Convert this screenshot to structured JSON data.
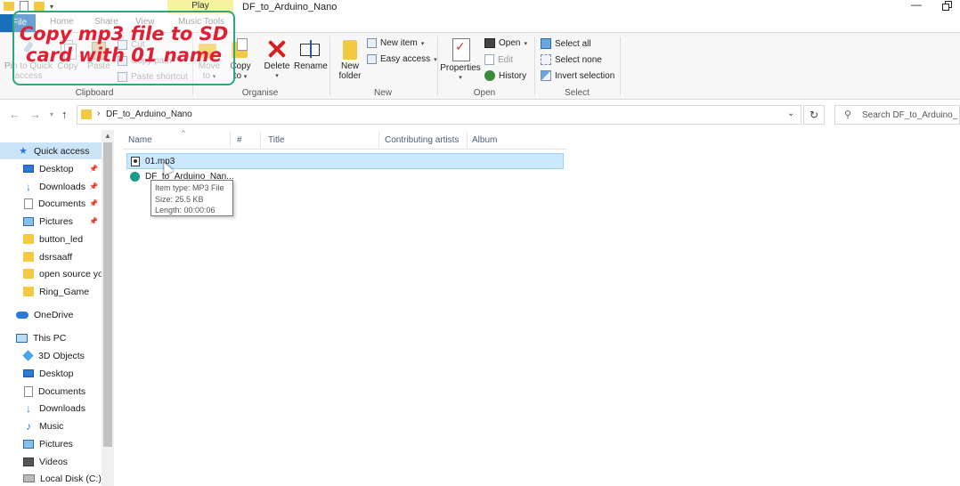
{
  "titlebar": {
    "contextual_tab": "Play",
    "window_title": "DF_to_Arduino_Nano",
    "minimize": "—"
  },
  "ribbon_tabs": {
    "file": "File",
    "home": "Home",
    "share": "Share",
    "view": "View",
    "music_tools": "Music Tools"
  },
  "ribbon": {
    "clipboard": {
      "pin_line1": "Pin to Quick",
      "pin_line2": "access",
      "copy": "Copy",
      "paste": "Paste",
      "cut": "Cut",
      "copy_path": "Copy path",
      "paste_shortcut": "Paste shortcut",
      "label": "Clipboard"
    },
    "organise": {
      "move_line1": "Move",
      "move_line2": "to",
      "copy_line1": "Copy",
      "copy_line2": "to",
      "delete": "Delete",
      "rename": "Rename",
      "label": "Organise"
    },
    "new": {
      "new_folder_line1": "New",
      "new_folder_line2": "folder",
      "new_item": "New item",
      "easy_access": "Easy access",
      "label": "New"
    },
    "open": {
      "properties": "Properties",
      "open": "Open",
      "edit": "Edit",
      "history": "History",
      "label": "Open"
    },
    "select": {
      "select_all": "Select all",
      "select_none": "Select none",
      "invert_selection": "Invert selection",
      "label": "Select"
    }
  },
  "annotation": {
    "line1": "Copy mp3 file to SD",
    "line2": "card with 01 name",
    "color": "#e41e32",
    "border_color": "#2aa878"
  },
  "address": {
    "path": "DF_to_Arduino_Nano",
    "search_placeholder": "Search DF_to_Arduino_N"
  },
  "sidebar": {
    "items": [
      {
        "label": "Quick access",
        "icon": "star-icon",
        "selected": true
      },
      {
        "label": "Desktop",
        "icon": "desktop-icon",
        "pinned": true
      },
      {
        "label": "Downloads",
        "icon": "downloads-icon",
        "pinned": true
      },
      {
        "label": "Documents",
        "icon": "documents-icon",
        "pinned": true
      },
      {
        "label": "Pictures",
        "icon": "pictures-icon",
        "pinned": true
      },
      {
        "label": "button_led",
        "icon": "folder-icon"
      },
      {
        "label": "dsrsaaff",
        "icon": "folder-icon"
      },
      {
        "label": "open source you",
        "icon": "folder-icon"
      },
      {
        "label": "Ring_Game",
        "icon": "folder-icon"
      },
      {
        "label": "OneDrive",
        "icon": "onedrive-icon"
      },
      {
        "label": "This PC",
        "icon": "pc-icon"
      },
      {
        "label": "3D Objects",
        "icon": "3d-objects-icon"
      },
      {
        "label": "Desktop",
        "icon": "desktop-icon"
      },
      {
        "label": "Documents",
        "icon": "documents-icon"
      },
      {
        "label": "Downloads",
        "icon": "downloads-icon"
      },
      {
        "label": "Music",
        "icon": "music-icon"
      },
      {
        "label": "Pictures",
        "icon": "pictures-icon"
      },
      {
        "label": "Videos",
        "icon": "videos-icon"
      },
      {
        "label": "Local Disk (C:)",
        "icon": "disk-icon"
      }
    ]
  },
  "columns": [
    "Name",
    "#",
    "Title",
    "Contributing artists",
    "Album"
  ],
  "files": [
    {
      "name": "01.mp3",
      "icon": "mp3-file-icon",
      "selected": true
    },
    {
      "name": "DF_to_Arduino_Nan...",
      "icon": "arduino-file-icon",
      "selected": false
    }
  ],
  "tooltip": {
    "type": "Item type: MP3 File",
    "size": "Size: 25.5 KB",
    "length": "Length: 00:00:06"
  }
}
